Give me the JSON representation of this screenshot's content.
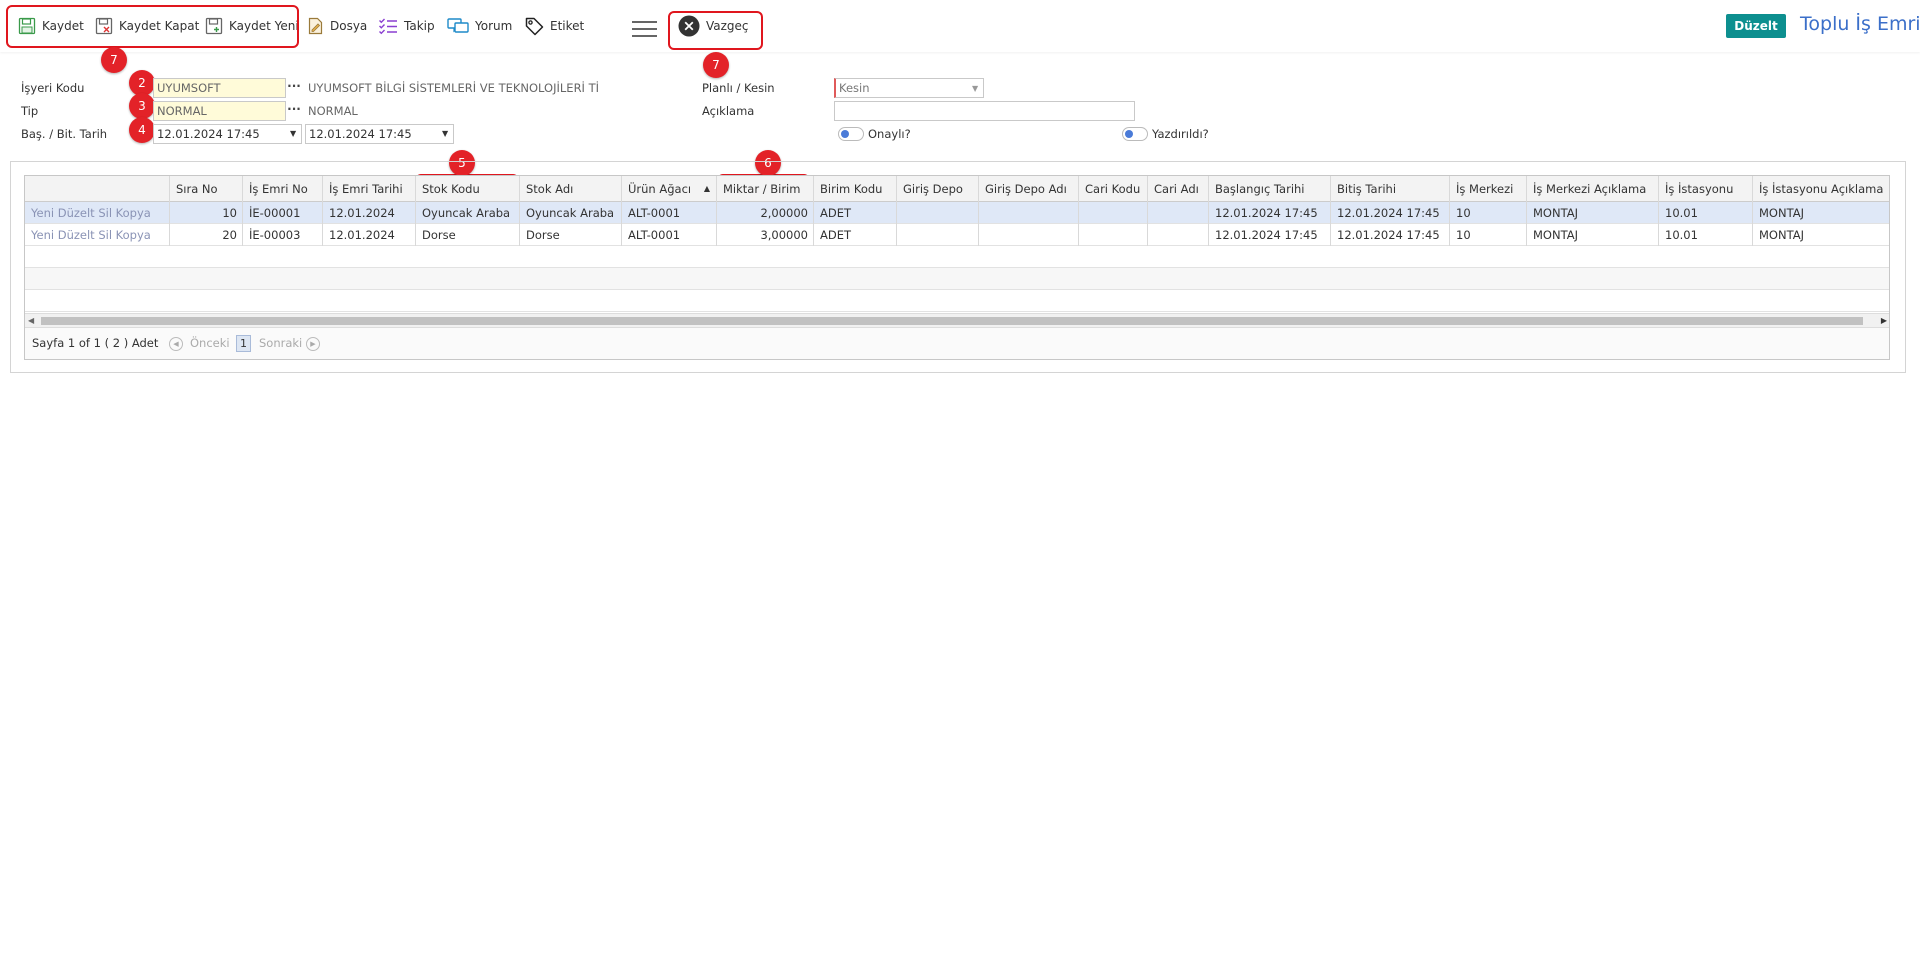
{
  "toolbar": {
    "save": "Kaydet",
    "save_close": "Kaydet Kapat",
    "save_new": "Kaydet Yeni",
    "file": "Dosya",
    "track": "Takip",
    "comment": "Yorum",
    "tag": "Etiket",
    "cancel": "Vazgeç"
  },
  "header": {
    "edit_button": "Düzelt",
    "title": "Toplu İş Emri"
  },
  "badges": {
    "b7a": "7",
    "b7b": "7",
    "b2": "2",
    "b3": "3",
    "b4": "4",
    "b5": "5",
    "b6": "6"
  },
  "form": {
    "workplace_label": "İşyeri Kodu",
    "workplace_value": "UYUMSOFT",
    "workplace_desc": "UYUMSOFT BİLGİ SİSTEMLERİ VE TEKNOLOJİLERİ Tİ",
    "type_label": "Tip",
    "type_value": "NORMAL",
    "type_desc": "NORMAL",
    "date_label": "Baş. / Bit. Tarih",
    "start_date": "12.01.2024 17:45",
    "end_date": "12.01.2024 17:45",
    "planned_label": "Planlı / Kesin",
    "planned_value": "Kesin",
    "desc_label": "Açıklama",
    "desc_value": "",
    "approved_label": "Onaylı?",
    "printed_label": "Yazdırıldı?"
  },
  "grid": {
    "columns": [
      "",
      "Sıra No",
      "İş Emri No",
      "İş Emri Tarihi",
      "Stok Kodu",
      "Stok Adı",
      "Ürün Ağacı",
      "Miktar / Birim",
      "Birim Kodu",
      "Giriş Depo",
      "Giriş Depo Adı",
      "Cari Kodu",
      "Cari Adı",
      "Başlangıç Tarihi",
      "Bitiş Tarihi",
      "İş Merkezi",
      "İş Merkezi Açıklama",
      "İş İstasyonu",
      "İş İstasyonu Açıklama"
    ],
    "sort_indicator": "▲",
    "rows": [
      {
        "actions": "Yeni Düzelt Sil Kopya",
        "seq": "10",
        "wo_no": "İE-00001",
        "wo_date": "12.01.2024",
        "stock_code": "Oyuncak Araba",
        "stock_name": "Oyuncak Araba",
        "bom": "ALT-0001",
        "qty": "2,00000",
        "unit": "ADET",
        "in_wh": "",
        "in_wh_name": "",
        "cust_code": "",
        "cust_name": "",
        "start": "12.01.2024 17:45",
        "end": "12.01.2024 17:45",
        "wc": "10",
        "wc_desc": "MONTAJ",
        "ws": "10.01",
        "ws_desc": "MONTAJ"
      },
      {
        "actions": "Yeni Düzelt Sil Kopya",
        "seq": "20",
        "wo_no": "İE-00003",
        "wo_date": "12.01.2024",
        "stock_code": "Dorse",
        "stock_name": "Dorse",
        "bom": "ALT-0001",
        "qty": "3,00000",
        "unit": "ADET",
        "in_wh": "",
        "in_wh_name": "",
        "cust_code": "",
        "cust_name": "",
        "start": "12.01.2024 17:45",
        "end": "12.01.2024 17:45",
        "wc": "10",
        "wc_desc": "MONTAJ",
        "ws": "10.01",
        "ws_desc": "MONTAJ"
      }
    ],
    "pager": {
      "summary": "Sayfa 1 of 1 ( 2 ) Adet",
      "prev": "Önceki",
      "page": "1",
      "next": "Sonraki"
    }
  },
  "colors": {
    "accent": "#0d8f8f",
    "title": "#3b6fc9",
    "annotation": "#e32228",
    "selected_row": "#dfe8f7"
  }
}
